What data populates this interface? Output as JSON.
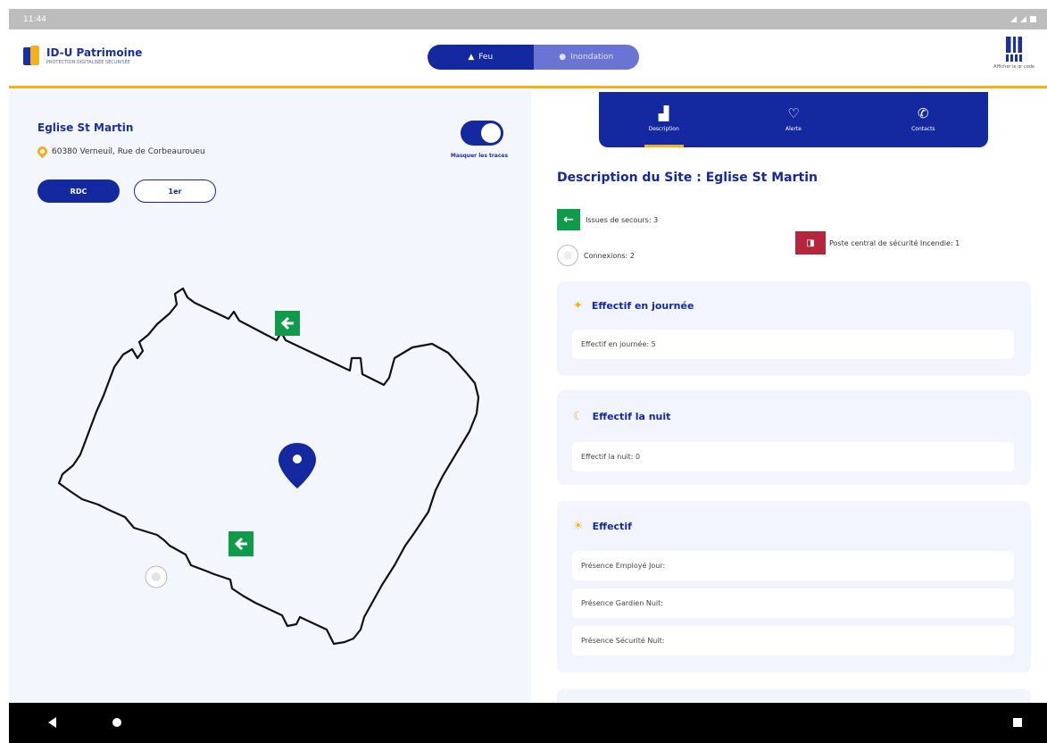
{
  "status_bar": {
    "time": "11:44"
  },
  "header": {
    "logo_title": "ID-U Patrimoine",
    "logo_subtitle": "PROTECTION DIGITALISÉE SÉCURISÉE",
    "segments": [
      {
        "label": "Feu",
        "icon": "flame-icon",
        "active": true
      },
      {
        "label": "Inondation",
        "icon": "drop-icon",
        "active": false
      }
    ],
    "qr_caption": "Afficher le qr code",
    "accent_color": "#f2b01e",
    "primary_color": "#1428a0"
  },
  "site": {
    "name": "Eglise St Martin",
    "address": "60380 Verneuil, Rue de Corbeauroueu",
    "levels": [
      {
        "label": "RDC",
        "active": true
      },
      {
        "label": "1er",
        "active": false
      }
    ],
    "toggle_label": "Masquer les traces",
    "toggle_on": true
  },
  "tabs": [
    {
      "label": "Description",
      "icon": "building-icon",
      "active": true
    },
    {
      "label": "Alerte",
      "icon": "heart-icon",
      "active": false
    },
    {
      "label": "Contacts",
      "icon": "phone-icon",
      "active": false
    }
  ],
  "description": {
    "title": "Description du Site : Eglise St Martin",
    "exits": "Issues de secours: 3",
    "connections": "Connexions: 2",
    "poste": "Poste central de sécurité Incendie: 1"
  },
  "cards": [
    {
      "title": "Effectif en journée",
      "icon": "sun-rise-icon",
      "rows": [
        "Effectif en journée: 5"
      ]
    },
    {
      "title": "Effectif la nuit",
      "icon": "moon-icon",
      "rows": [
        "Effectif la nuit: 0"
      ]
    },
    {
      "title": "Effectif",
      "icon": "sun-icon",
      "rows": [
        "Présence Employé Jour:",
        "Présence Gardien Nuit:",
        "Présence Sécurité Nuit:"
      ]
    }
  ]
}
